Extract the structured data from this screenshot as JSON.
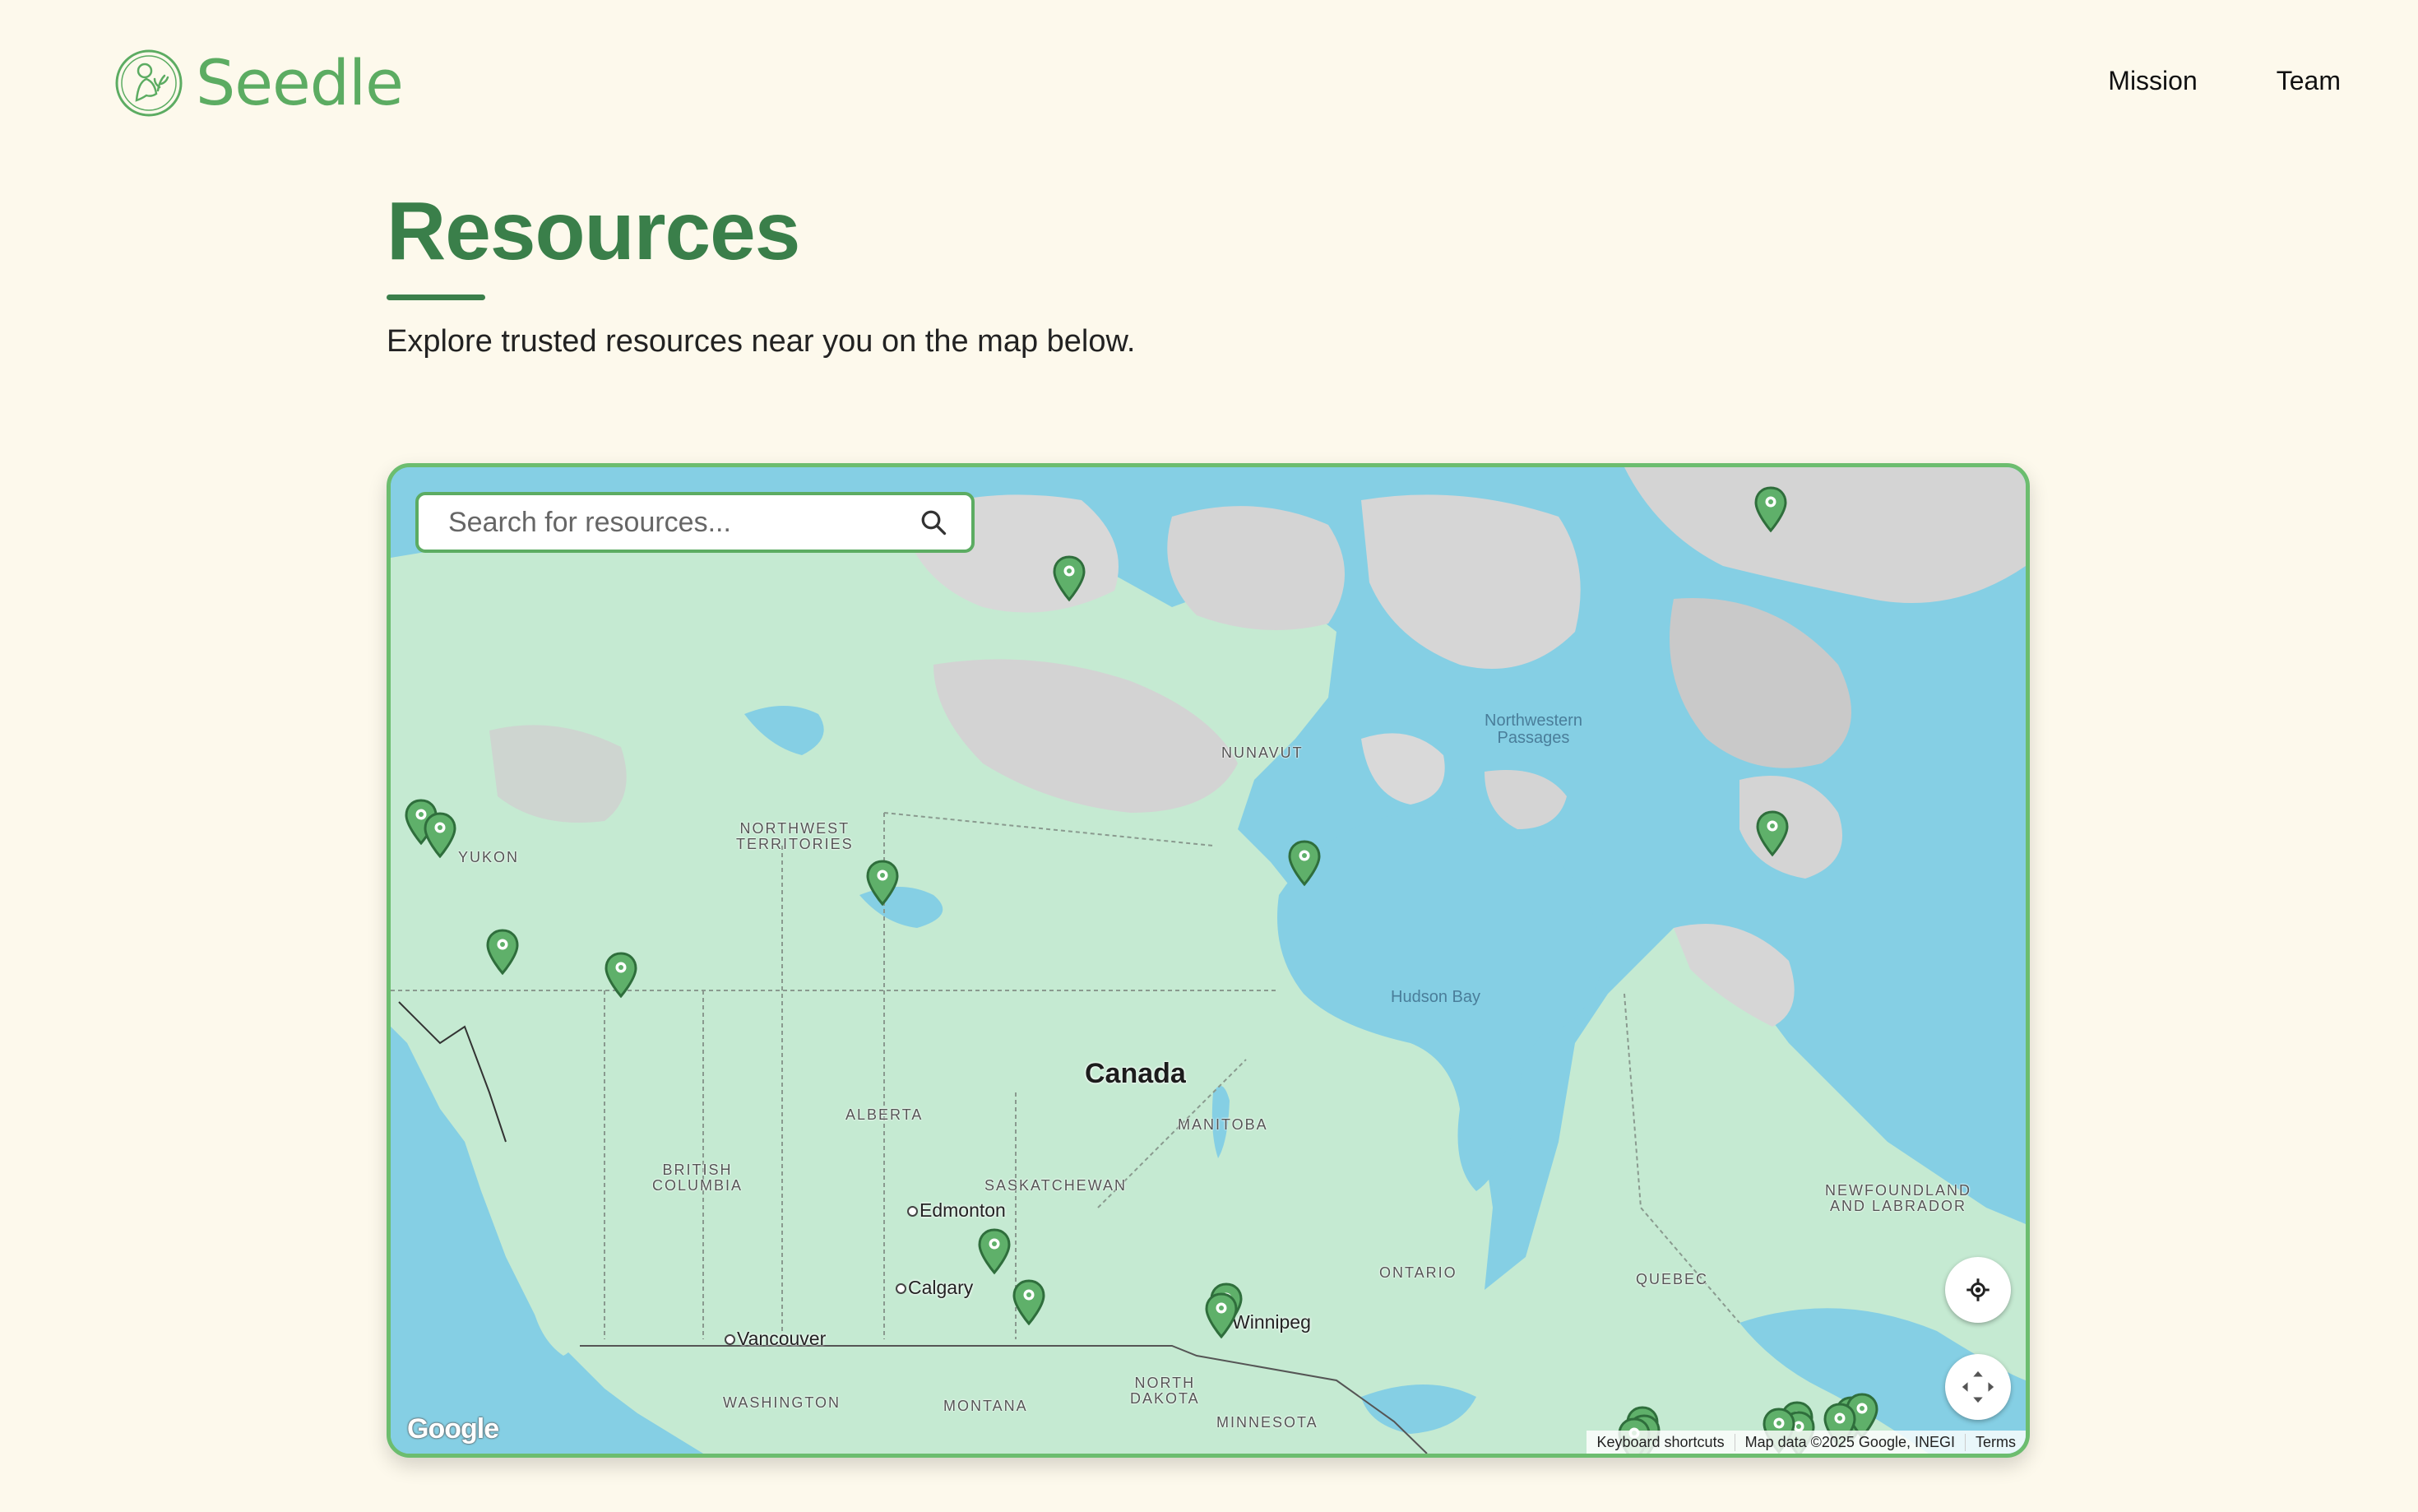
{
  "brand": {
    "name": "Seedle",
    "logo_icon": "seedling-mother-icon"
  },
  "nav": {
    "items": [
      "Mission",
      "Team"
    ]
  },
  "page": {
    "title": "Resources",
    "subtitle": "Explore trusted resources near you on the map below."
  },
  "map": {
    "search_placeholder": "Search for resources...",
    "country_label": "Canada",
    "region_labels": {
      "nunavut": "NUNAVUT",
      "nwt": "NORTHWEST\nTERRITORIES",
      "yukon": "YUKON",
      "alberta": "ALBERTA",
      "bc": "BRITISH\nCOLUMBIA",
      "saskatchewan": "SASKATCHEWAN",
      "manitoba": "MANITOBA",
      "ontario": "ONTARIO",
      "quebec": "QUEBEC",
      "newfoundland": "NEWFOUNDLAND\nAND LABRADOR",
      "washington": "WASHINGTON",
      "montana": "MONTANA",
      "north_dakota": "NORTH\nDAKOTA",
      "minnesota": "MINNESOTA"
    },
    "water_labels": {
      "passages": "Northwestern\nPassages",
      "hudson": "Hudson Bay"
    },
    "cities": {
      "edmonton": "Edmonton",
      "calgary": "Calgary",
      "vancouver": "Vancouver",
      "winnipeg": "Winnipeg"
    },
    "marker_count_visible": 22,
    "marker_color": "#5fb06a",
    "google_logo": "Google",
    "attribution": {
      "shortcuts": "Keyboard shortcuts",
      "data": "Map data ©2025 Google, INEGI",
      "terms": "Terms"
    },
    "controls": {
      "locate_icon": "my-location-icon",
      "fullscreen_icon": "fullscreen-icon"
    }
  },
  "colors": {
    "brand_green": "#3a7f4a",
    "logo_green": "#5cac62",
    "background": "#fdf9ec",
    "water": "#85cfe4",
    "land": "#c5ead2"
  }
}
